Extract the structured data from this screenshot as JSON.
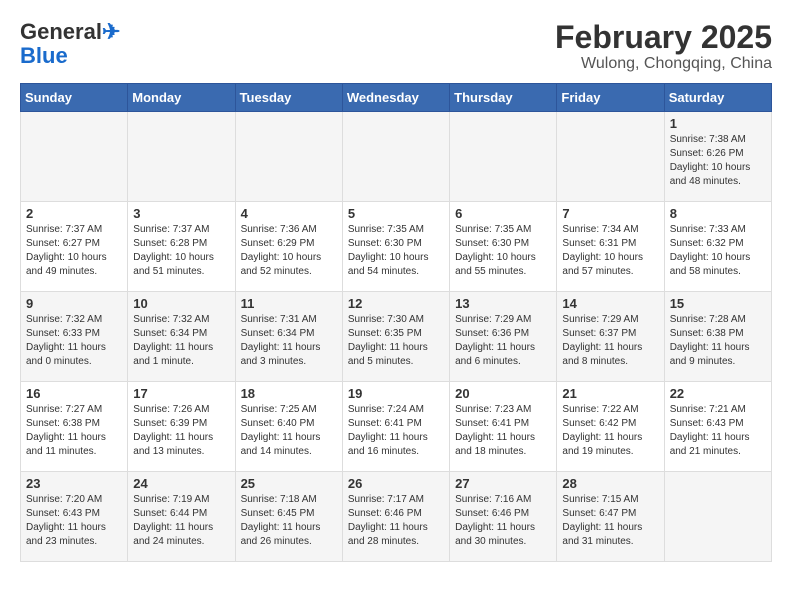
{
  "header": {
    "logo_general": "General",
    "logo_blue": "Blue",
    "month_title": "February 2025",
    "location": "Wulong, Chongqing, China"
  },
  "weekdays": [
    "Sunday",
    "Monday",
    "Tuesday",
    "Wednesday",
    "Thursday",
    "Friday",
    "Saturday"
  ],
  "weeks": [
    [
      {
        "day": "",
        "info": ""
      },
      {
        "day": "",
        "info": ""
      },
      {
        "day": "",
        "info": ""
      },
      {
        "day": "",
        "info": ""
      },
      {
        "day": "",
        "info": ""
      },
      {
        "day": "",
        "info": ""
      },
      {
        "day": "1",
        "info": "Sunrise: 7:38 AM\nSunset: 6:26 PM\nDaylight: 10 hours\nand 48 minutes."
      }
    ],
    [
      {
        "day": "2",
        "info": "Sunrise: 7:37 AM\nSunset: 6:27 PM\nDaylight: 10 hours\nand 49 minutes."
      },
      {
        "day": "3",
        "info": "Sunrise: 7:37 AM\nSunset: 6:28 PM\nDaylight: 10 hours\nand 51 minutes."
      },
      {
        "day": "4",
        "info": "Sunrise: 7:36 AM\nSunset: 6:29 PM\nDaylight: 10 hours\nand 52 minutes."
      },
      {
        "day": "5",
        "info": "Sunrise: 7:35 AM\nSunset: 6:30 PM\nDaylight: 10 hours\nand 54 minutes."
      },
      {
        "day": "6",
        "info": "Sunrise: 7:35 AM\nSunset: 6:30 PM\nDaylight: 10 hours\nand 55 minutes."
      },
      {
        "day": "7",
        "info": "Sunrise: 7:34 AM\nSunset: 6:31 PM\nDaylight: 10 hours\nand 57 minutes."
      },
      {
        "day": "8",
        "info": "Sunrise: 7:33 AM\nSunset: 6:32 PM\nDaylight: 10 hours\nand 58 minutes."
      }
    ],
    [
      {
        "day": "9",
        "info": "Sunrise: 7:32 AM\nSunset: 6:33 PM\nDaylight: 11 hours\nand 0 minutes."
      },
      {
        "day": "10",
        "info": "Sunrise: 7:32 AM\nSunset: 6:34 PM\nDaylight: 11 hours\nand 1 minute."
      },
      {
        "day": "11",
        "info": "Sunrise: 7:31 AM\nSunset: 6:34 PM\nDaylight: 11 hours\nand 3 minutes."
      },
      {
        "day": "12",
        "info": "Sunrise: 7:30 AM\nSunset: 6:35 PM\nDaylight: 11 hours\nand 5 minutes."
      },
      {
        "day": "13",
        "info": "Sunrise: 7:29 AM\nSunset: 6:36 PM\nDaylight: 11 hours\nand 6 minutes."
      },
      {
        "day": "14",
        "info": "Sunrise: 7:29 AM\nSunset: 6:37 PM\nDaylight: 11 hours\nand 8 minutes."
      },
      {
        "day": "15",
        "info": "Sunrise: 7:28 AM\nSunset: 6:38 PM\nDaylight: 11 hours\nand 9 minutes."
      }
    ],
    [
      {
        "day": "16",
        "info": "Sunrise: 7:27 AM\nSunset: 6:38 PM\nDaylight: 11 hours\nand 11 minutes."
      },
      {
        "day": "17",
        "info": "Sunrise: 7:26 AM\nSunset: 6:39 PM\nDaylight: 11 hours\nand 13 minutes."
      },
      {
        "day": "18",
        "info": "Sunrise: 7:25 AM\nSunset: 6:40 PM\nDaylight: 11 hours\nand 14 minutes."
      },
      {
        "day": "19",
        "info": "Sunrise: 7:24 AM\nSunset: 6:41 PM\nDaylight: 11 hours\nand 16 minutes."
      },
      {
        "day": "20",
        "info": "Sunrise: 7:23 AM\nSunset: 6:41 PM\nDaylight: 11 hours\nand 18 minutes."
      },
      {
        "day": "21",
        "info": "Sunrise: 7:22 AM\nSunset: 6:42 PM\nDaylight: 11 hours\nand 19 minutes."
      },
      {
        "day": "22",
        "info": "Sunrise: 7:21 AM\nSunset: 6:43 PM\nDaylight: 11 hours\nand 21 minutes."
      }
    ],
    [
      {
        "day": "23",
        "info": "Sunrise: 7:20 AM\nSunset: 6:43 PM\nDaylight: 11 hours\nand 23 minutes."
      },
      {
        "day": "24",
        "info": "Sunrise: 7:19 AM\nSunset: 6:44 PM\nDaylight: 11 hours\nand 24 minutes."
      },
      {
        "day": "25",
        "info": "Sunrise: 7:18 AM\nSunset: 6:45 PM\nDaylight: 11 hours\nand 26 minutes."
      },
      {
        "day": "26",
        "info": "Sunrise: 7:17 AM\nSunset: 6:46 PM\nDaylight: 11 hours\nand 28 minutes."
      },
      {
        "day": "27",
        "info": "Sunrise: 7:16 AM\nSunset: 6:46 PM\nDaylight: 11 hours\nand 30 minutes."
      },
      {
        "day": "28",
        "info": "Sunrise: 7:15 AM\nSunset: 6:47 PM\nDaylight: 11 hours\nand 31 minutes."
      },
      {
        "day": "",
        "info": ""
      }
    ]
  ]
}
